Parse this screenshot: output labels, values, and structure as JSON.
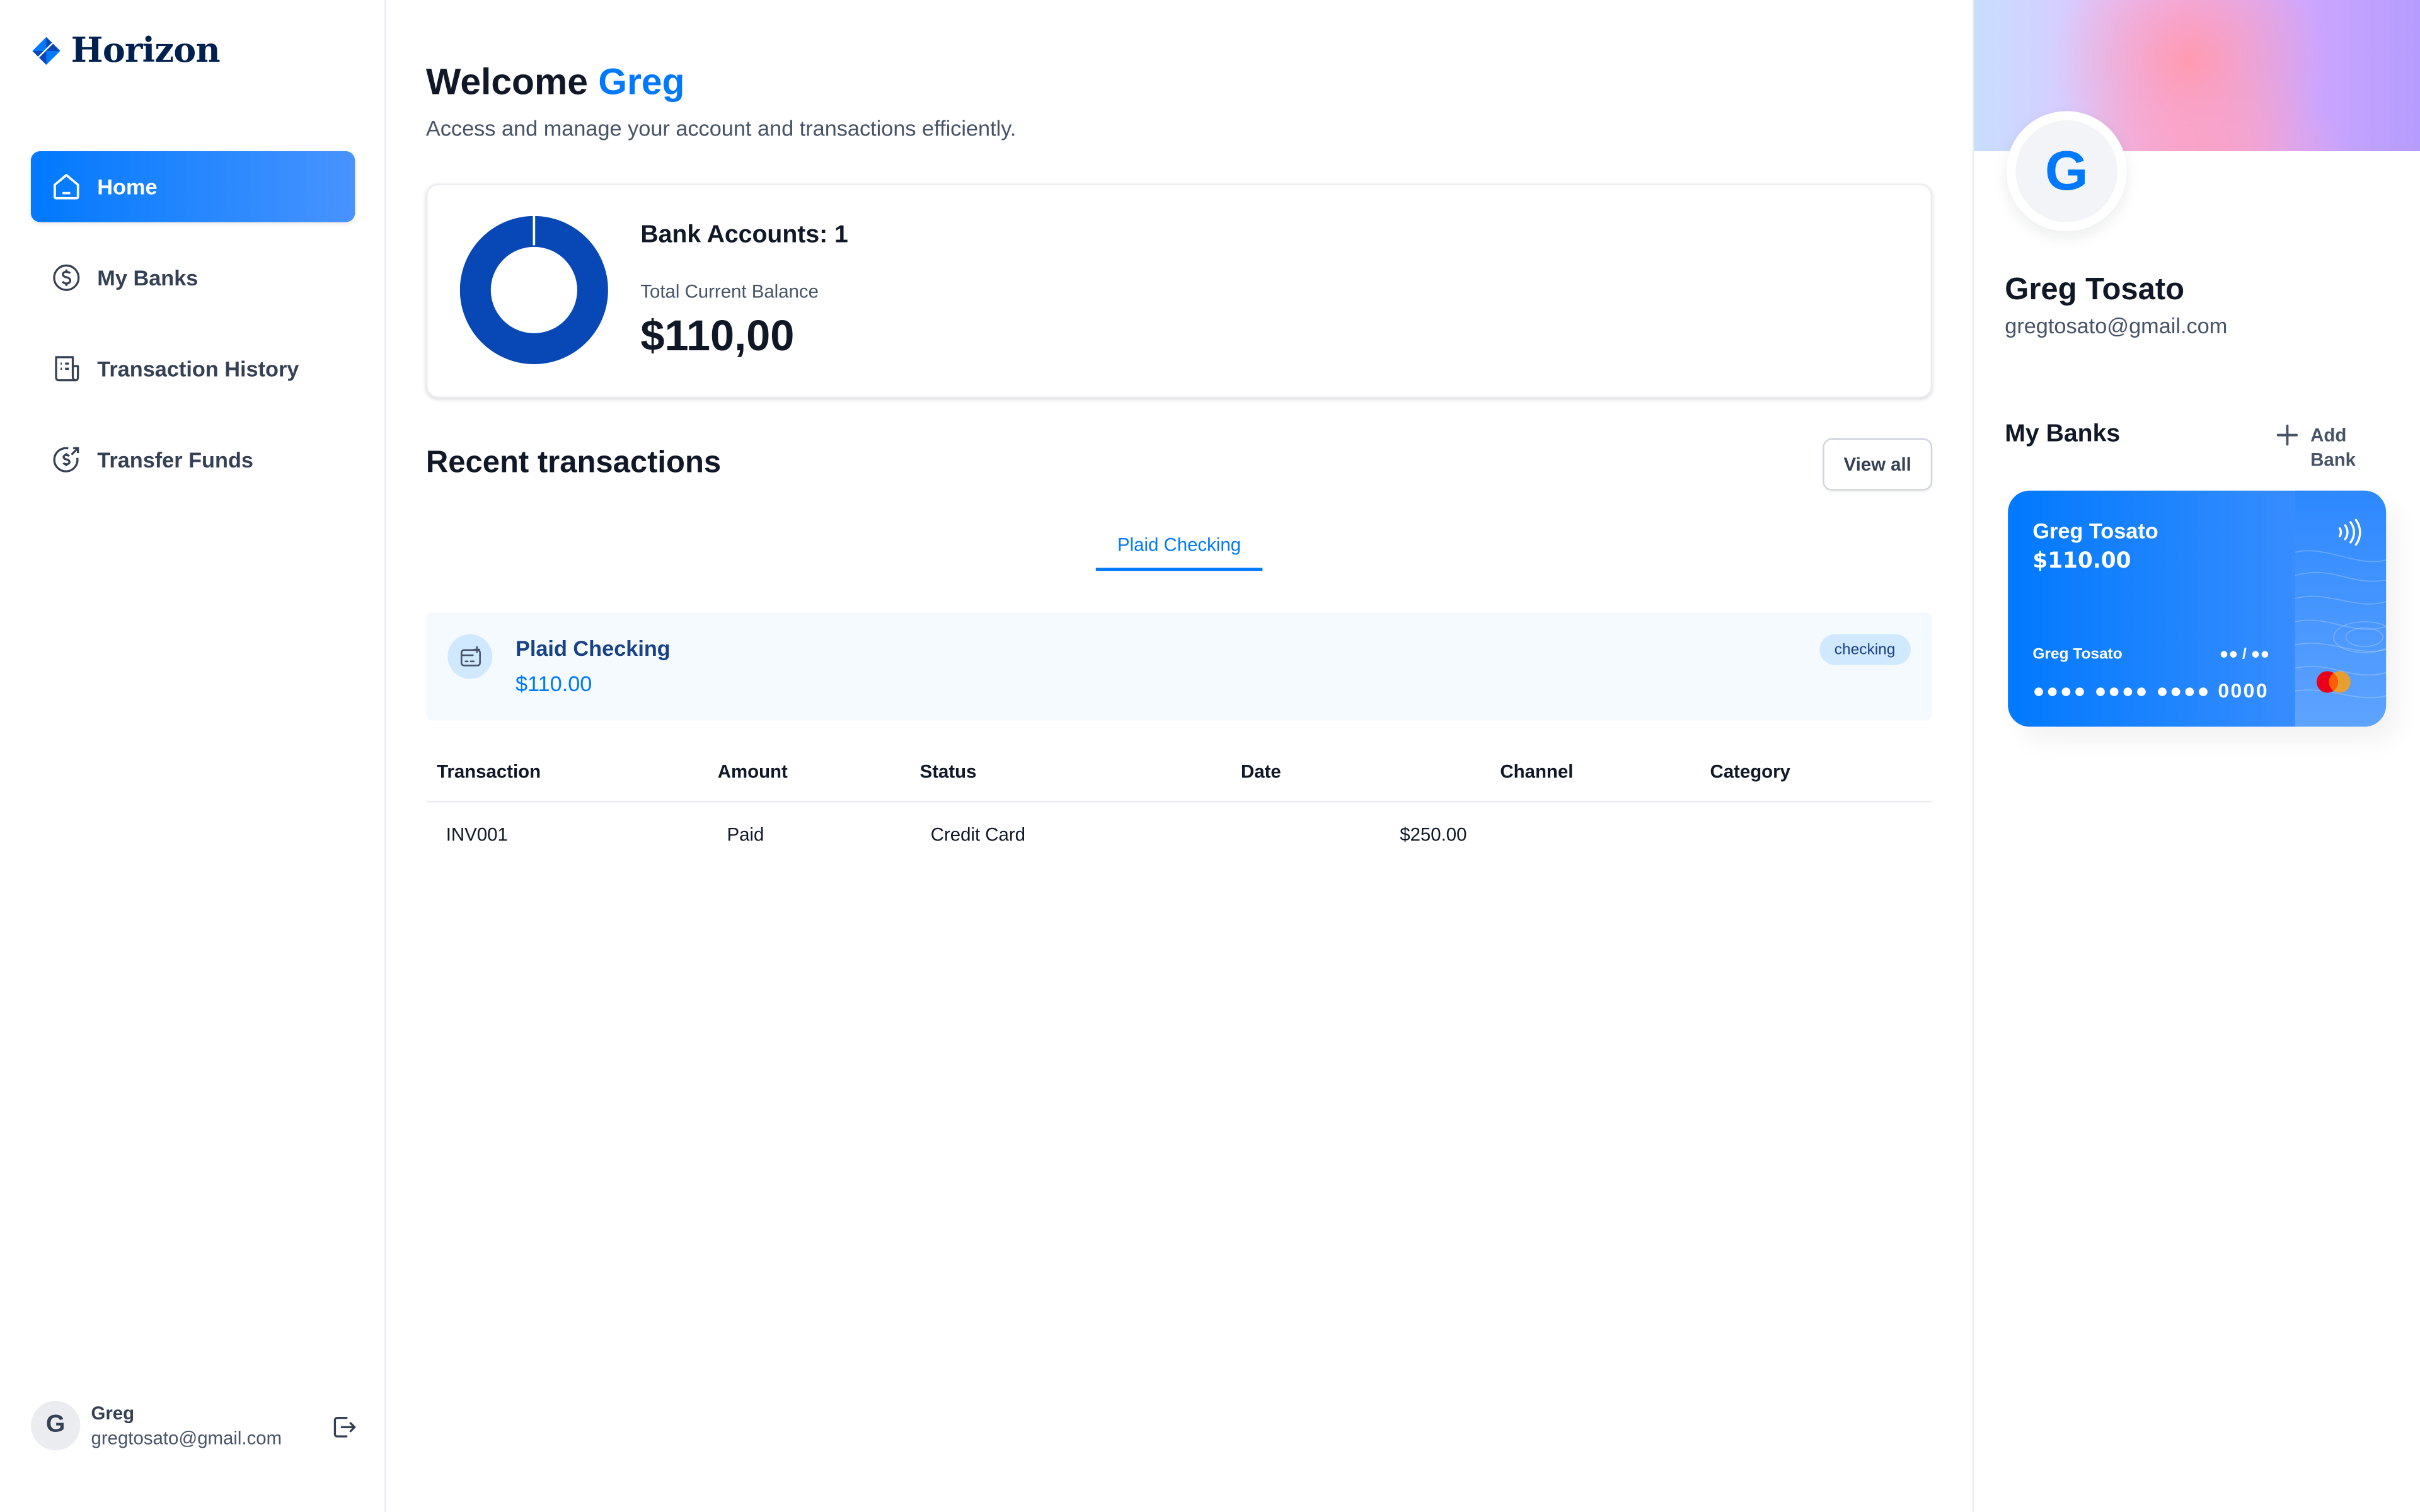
{
  "app": {
    "name": "Horizon"
  },
  "sidebar": {
    "items": [
      {
        "label": "Home",
        "icon": "home-icon",
        "active": true
      },
      {
        "label": "My Banks",
        "icon": "dollar-circle-icon",
        "active": false
      },
      {
        "label": "Transaction History",
        "icon": "receipt-icon",
        "active": false
      },
      {
        "label": "Transfer Funds",
        "icon": "money-send-icon",
        "active": false
      }
    ],
    "footer": {
      "initial": "G",
      "name": "Greg",
      "email": "gregtosato@gmail.com"
    }
  },
  "header": {
    "welcome": "Welcome",
    "user": "Greg",
    "subtitle": "Access and manage your account and transactions efficiently."
  },
  "balance": {
    "accounts_label": "Bank Accounts: 1",
    "total_label": "Total Current Balance",
    "total_value": "$110,00"
  },
  "recent": {
    "title": "Recent transactions",
    "view_all": "View all",
    "tab": "Plaid Checking",
    "bank": {
      "name": "Plaid Checking",
      "balance": "$110.00",
      "type": "checking"
    },
    "columns": [
      "Transaction",
      "Amount",
      "Status",
      "Date",
      "Channel",
      "Category"
    ],
    "rows": [
      {
        "transaction": "INV001",
        "amount": "Paid",
        "status": "Credit Card",
        "date": "$250.00"
      }
    ]
  },
  "profile": {
    "initial": "G",
    "name": "Greg Tosato",
    "email": "gregtosato@gmail.com"
  },
  "my_banks": {
    "title": "My Banks",
    "add_label": "Add Bank",
    "card": {
      "name": "Greg Tosato",
      "balance": "$110.00",
      "holder": "Greg Tosato",
      "expiry": "●● / ●●",
      "number": "●●●● ●●●● ●●●● 0000"
    }
  },
  "colors": {
    "accent": "#0179FE",
    "donut": "#0747B6",
    "navy": "#194185"
  }
}
